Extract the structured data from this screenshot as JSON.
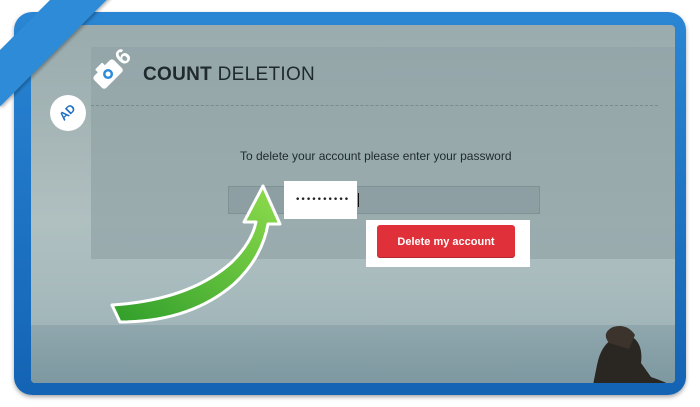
{
  "header": {
    "title_bold": "COUNT",
    "title_rest": " DELETION"
  },
  "form": {
    "instruction": "To delete your account please enter your password",
    "password_value": "••••••••••",
    "delete_button_label": "Delete my account"
  },
  "ribbon": {
    "badge_text": "AD",
    "step_number": "6",
    "icon": "camera-icon"
  },
  "colors": {
    "frame": "#1a6fc4",
    "delete_button": "#e0313b",
    "arrow": "#5bbf3a"
  }
}
